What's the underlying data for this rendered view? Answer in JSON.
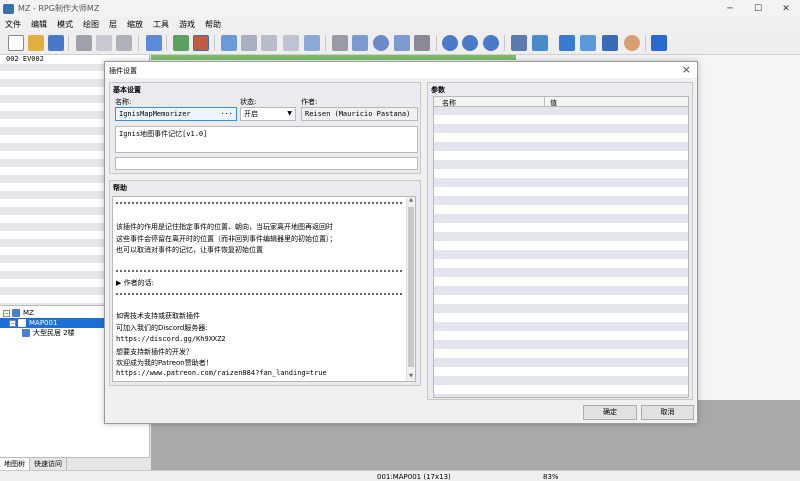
{
  "window": {
    "title": "MZ - RPG制作大师MZ"
  },
  "menubar": [
    "文件",
    "编辑",
    "模式",
    "绘图",
    "层",
    "缩放",
    "工具",
    "游戏",
    "帮助"
  ],
  "left_panel": {
    "event_header": "002 EV002",
    "tree": [
      {
        "label": "MZ"
      },
      {
        "label": "MAP001"
      },
      {
        "label": "大型民居 2楼"
      }
    ],
    "tabs": [
      "地图树",
      "快速访问"
    ]
  },
  "dialog": {
    "title": "插件设置",
    "basic": {
      "section_title": "基本设置",
      "name_label": "名称:",
      "name_value": "IgnisMapMemorizer",
      "status_label": "状态:",
      "status_value": "开启",
      "author_label": "作者:",
      "author_value": "Reisen (Mauricio Pastana)",
      "description": "Ignis地图事件记忆[v1.0]"
    },
    "help": {
      "section_title": "帮助",
      "lines": [
        "该插件的作用是记住指定事件的位置、朝向，当玩家离开地图再返回时",
        "这些事件会停留在离开时的位置（而非回到事件编辑器里的初始位置）；",
        "也可以取消对事件的记忆，让事件恢复初始位置",
        "▶ 作者的话:",
        "如需技术支持或获取新插件",
        "可加入我们的Discord服务器:",
        "https://discord.gg/Kh9XXZ2",
        "想要支持新插件的开发？",
        "欢迎成为我的Patreon赞助者！",
        "https://www.patreon.com/raizen884?fan_landing=true"
      ]
    },
    "params": {
      "section_title": "参数",
      "col_name": "名称",
      "col_value": "值"
    },
    "ok_label": "确定",
    "cancel_label": "取消"
  },
  "statusbar": {
    "map_info": "001:MAP001 (17x13)",
    "zoom": "83%"
  },
  "colors": {
    "selection": "#1e6ed8",
    "map_green": "#7bbf6a"
  }
}
